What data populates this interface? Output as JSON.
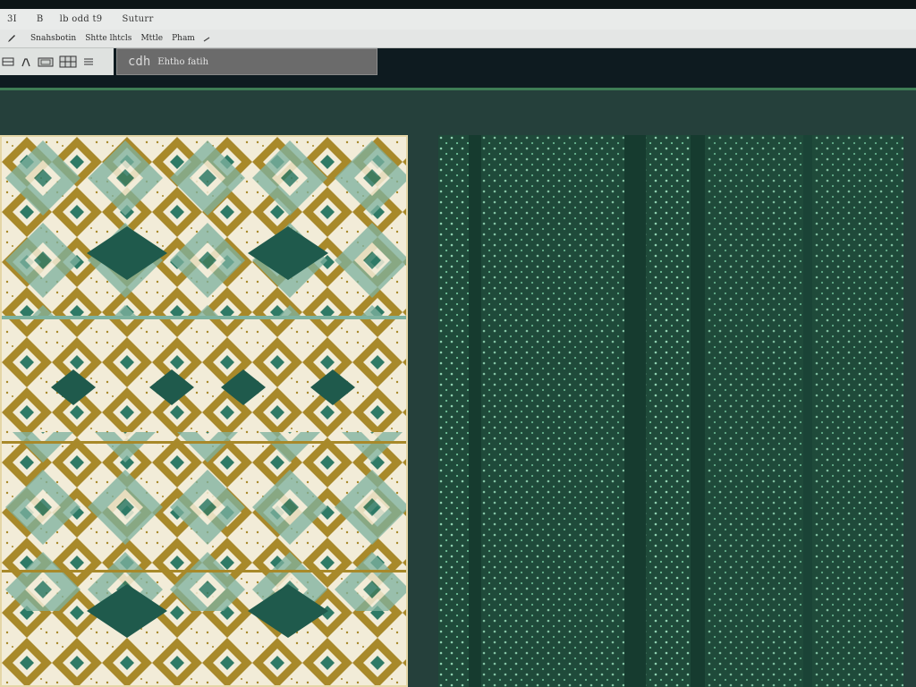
{
  "menubar": {
    "items": [
      "3I",
      "B",
      "lb odd t9",
      "Suturr"
    ]
  },
  "toolbar": {
    "items": [
      "Snahsbotin",
      "Shtte lhtcls",
      "Mttle",
      "Pham"
    ]
  },
  "document_tab": {
    "icon": "cdh",
    "label": "Ehtho fatih"
  },
  "colors": {
    "cream": "#f2ecd8",
    "ochre": "#a8892a",
    "teal": "#2f7a66",
    "sage": "#7fb29f",
    "dark_green": "#1f4a3a",
    "workspace": "#25403b",
    "accent_line": "#3e7d55"
  },
  "icons": [
    "pencil-icon",
    "chevron-icon",
    "layers-icon",
    "brush-icon",
    "frame-icon",
    "grid-icon"
  ]
}
